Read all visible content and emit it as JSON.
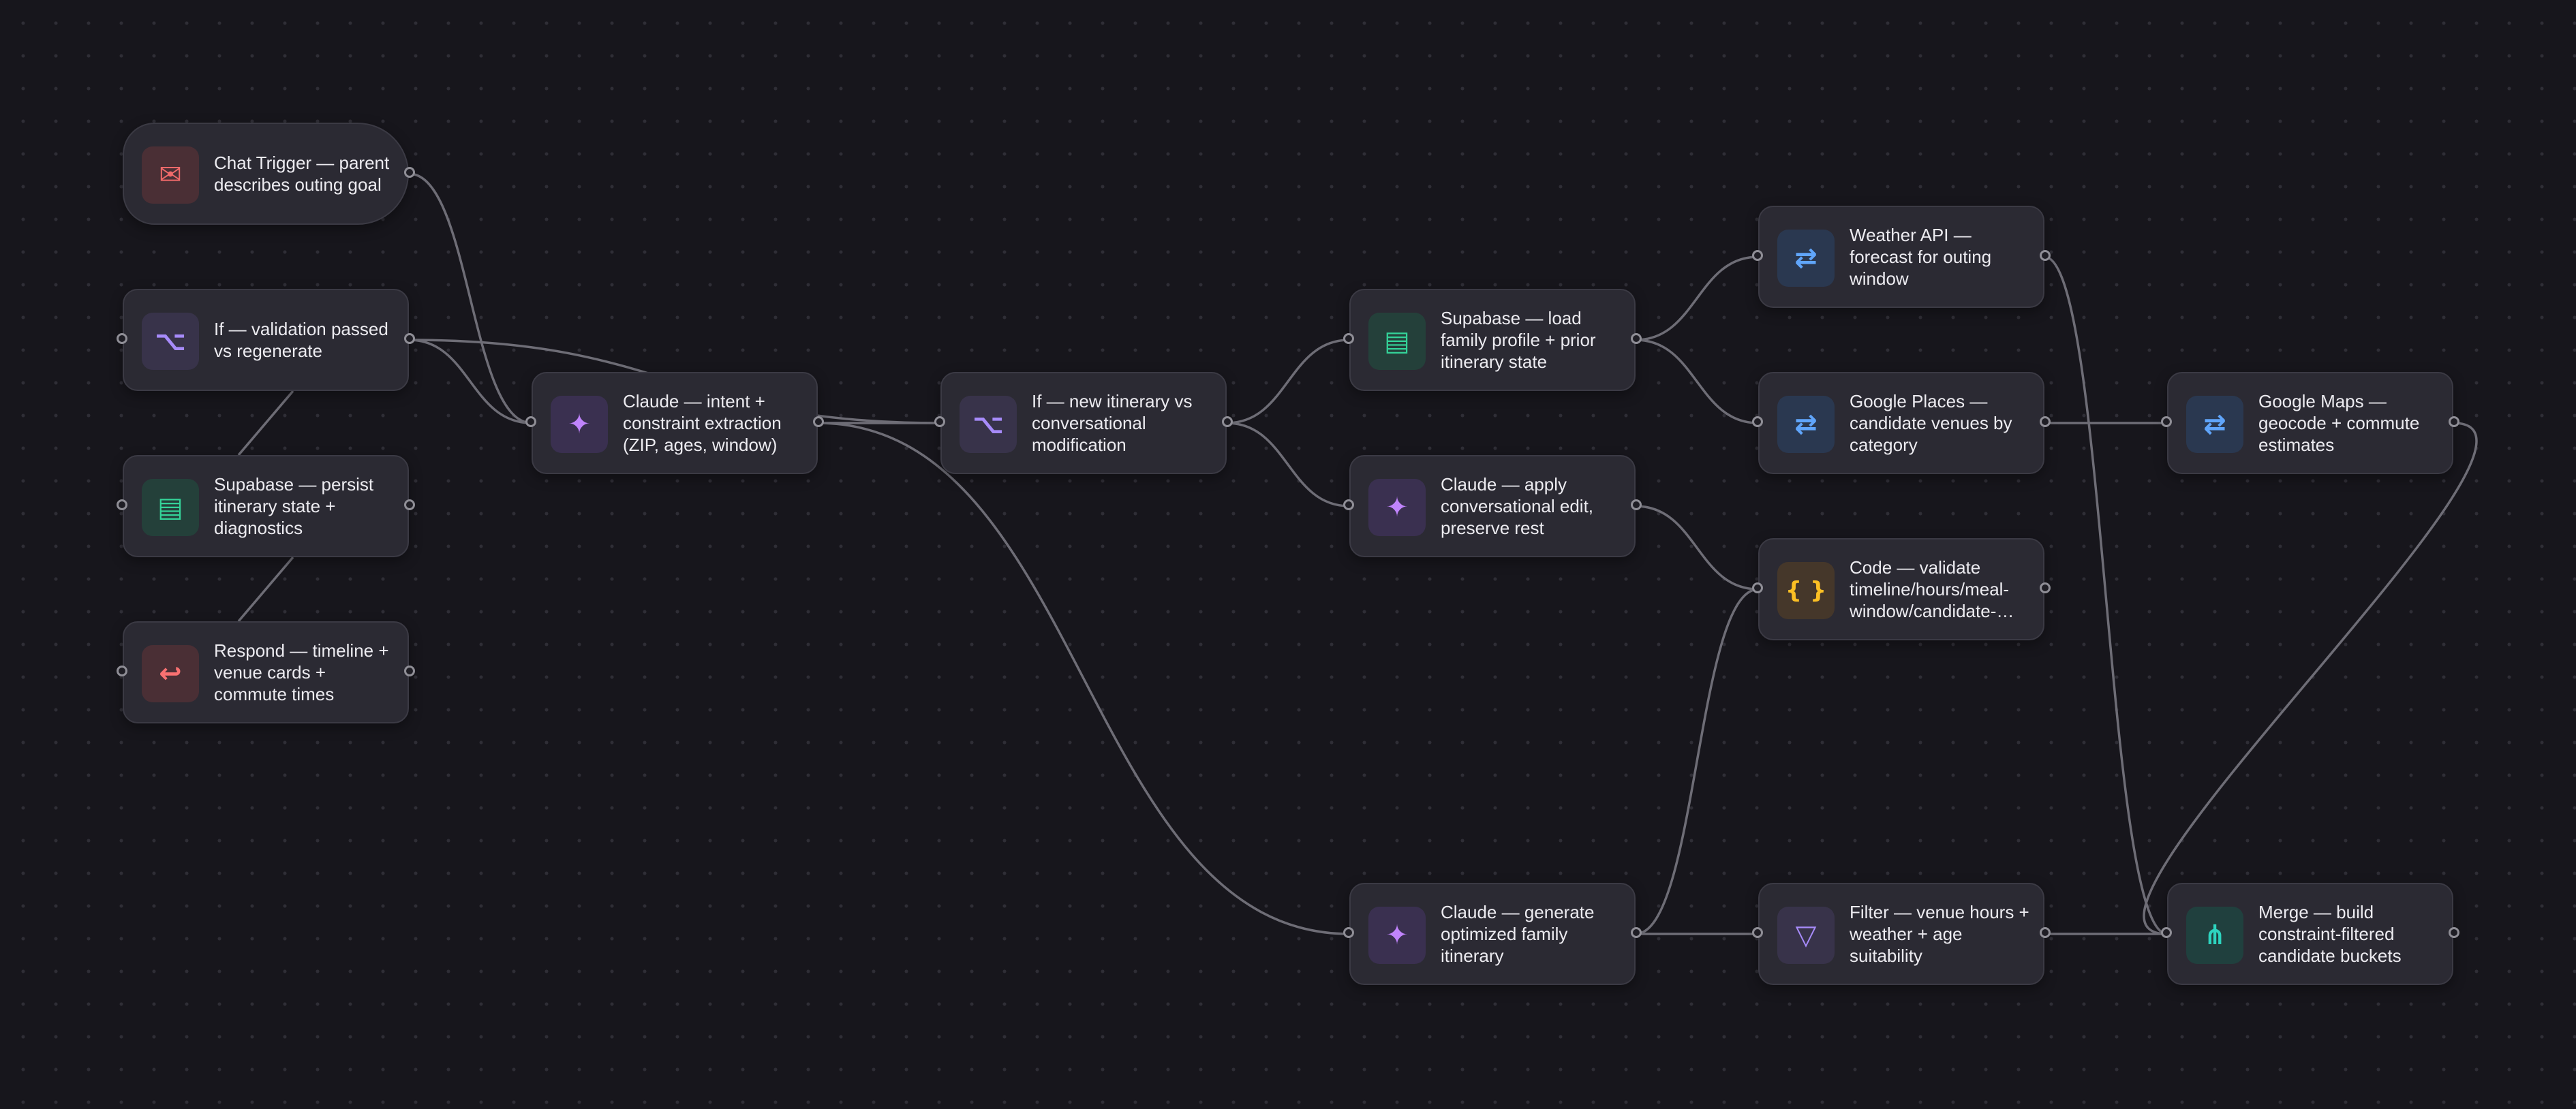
{
  "nodes": [
    {
      "id": "chat-trigger",
      "label": "Chat Trigger — parent describes outing goal",
      "icon": "envelope-icon",
      "glyph": "✉",
      "icon_color": "#f06a6a",
      "icon_bg": "#4a2f35",
      "shape": "trigger"
    },
    {
      "id": "if-validation",
      "label": "If — validation passed vs regenerate",
      "icon": "branch-icon",
      "glyph": "⌥",
      "icon_color": "#a78bfa",
      "icon_bg": "#38334a"
    },
    {
      "id": "supabase-persist",
      "label": "Supabase — persist itinerary state + diagnostics",
      "icon": "database-icon",
      "glyph": "▤",
      "icon_color": "#34d399",
      "icon_bg": "#24403a"
    },
    {
      "id": "respond",
      "label": "Respond — timeline + venue cards + commute times",
      "icon": "reply-icon",
      "glyph": "↩",
      "icon_color": "#f87171",
      "icon_bg": "#4a2f35"
    },
    {
      "id": "claude-intent",
      "label": "Claude — intent + constraint extraction (ZIP, ages, window)",
      "icon": "sparkle-icon",
      "glyph": "✦",
      "icon_color": "#c084fc",
      "icon_bg": "#3a3050"
    },
    {
      "id": "if-new-itinerary",
      "label": "If — new itinerary vs conversational modification",
      "icon": "branch-icon",
      "glyph": "⌥",
      "icon_color": "#a78bfa",
      "icon_bg": "#38334a"
    },
    {
      "id": "supabase-load",
      "label": "Supabase — load family profile + prior itinerary state",
      "icon": "database-icon",
      "glyph": "▤",
      "icon_color": "#34d399",
      "icon_bg": "#24403a"
    },
    {
      "id": "claude-apply",
      "label": "Claude — apply conversational edit, preserve rest",
      "icon": "sparkle-icon",
      "glyph": "✦",
      "icon_color": "#c084fc",
      "icon_bg": "#3a3050"
    },
    {
      "id": "claude-generate",
      "label": "Claude — generate optimized family itinerary",
      "icon": "sparkle-icon",
      "glyph": "✦",
      "icon_color": "#c084fc",
      "icon_bg": "#3a3050"
    },
    {
      "id": "weather-api",
      "label": "Weather API — forecast for outing window",
      "icon": "arrows-exchange-icon",
      "glyph": "⇄",
      "icon_color": "#60a5fa",
      "icon_bg": "#2a3850"
    },
    {
      "id": "google-places",
      "label": "Google Places — candidate venues by category",
      "icon": "arrows-exchange-icon",
      "glyph": "⇄",
      "icon_color": "#60a5fa",
      "icon_bg": "#2a3850"
    },
    {
      "id": "code-validate",
      "label": "Code — validate timeline/hours/meal-window/candidate-…",
      "icon": "code-braces-icon",
      "glyph": "{ }",
      "icon_color": "#fbbf24",
      "icon_bg": "#45372a"
    },
    {
      "id": "filter",
      "label": "Filter — venue hours + weather + age suitability",
      "icon": "filter-funnel-icon",
      "glyph": "▽",
      "icon_color": "#a78bfa",
      "icon_bg": "#38334a"
    },
    {
      "id": "google-maps",
      "label": "Google Maps — geocode + commute estimates",
      "icon": "arrows-exchange-icon",
      "glyph": "⇄",
      "icon_color": "#60a5fa",
      "icon_bg": "#2a3850"
    },
    {
      "id": "merge",
      "label": "Merge — build constraint-filtered candidate buckets",
      "icon": "merge-icon",
      "glyph": "⋔",
      "icon_color": "#2dd4bf",
      "icon_bg": "#20403e"
    }
  ],
  "edges": [
    [
      "chat-trigger",
      "claude-intent"
    ],
    [
      "claude-intent",
      "if-new-itinerary"
    ],
    [
      "if-new-itinerary",
      "supabase-load"
    ],
    [
      "if-new-itinerary",
      "claude-apply"
    ],
    [
      "supabase-load",
      "weather-api"
    ],
    [
      "supabase-load",
      "google-places"
    ],
    [
      "google-places",
      "google-maps"
    ],
    [
      "claude-intent",
      "claude-generate"
    ],
    [
      "claude-generate",
      "filter"
    ],
    [
      "filter",
      "merge"
    ],
    [
      "weather-api",
      "merge"
    ],
    [
      "google-maps",
      "merge"
    ],
    [
      "claude-generate",
      "code-validate"
    ],
    [
      "claude-apply",
      "code-validate"
    ],
    [
      "if-validation",
      "claude-intent"
    ],
    [
      "if-validation",
      "if-new-itinerary"
    ]
  ],
  "colors": {
    "background": "#17161c",
    "node_fill": "#2b2a33",
    "node_border": "#3b3a44",
    "edge": "#6e6d76",
    "text": "#ecebf0"
  }
}
